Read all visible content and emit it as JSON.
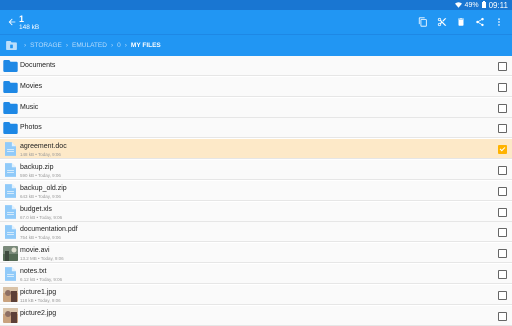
{
  "status": {
    "battery": "49%",
    "time": "09:11"
  },
  "appbar": {
    "title": "1",
    "subtitle": "148 kB"
  },
  "colors": {
    "primary": "#2196f3",
    "statusbar": "#1976d2",
    "selected_row": "#fde9c8",
    "checkbox_on": "#ffb300",
    "folder": "#1e88e5",
    "file_icon": "#90caf9"
  },
  "breadcrumb": [
    "STORAGE",
    "EMULATED",
    "0",
    "MY FILES"
  ],
  "rows": [
    {
      "name": "Documents",
      "type": "folder"
    },
    {
      "name": "Movies",
      "type": "folder"
    },
    {
      "name": "Music",
      "type": "folder"
    },
    {
      "name": "Photos",
      "type": "folder"
    },
    {
      "name": "agreement.doc",
      "meta": "148 kB • Today, 9:06",
      "type": "doc",
      "checked": true
    },
    {
      "name": "backup.zip",
      "meta": "590 kB • Today, 9:06",
      "type": "zip"
    },
    {
      "name": "backup_old.zip",
      "meta": "643 kB • Today, 9:06",
      "type": "zip"
    },
    {
      "name": "budget.xls",
      "meta": "67.0 kB • Today, 9:06",
      "type": "xls"
    },
    {
      "name": "documentation.pdf",
      "meta": "754 kB • Today, 9:06",
      "type": "pdf"
    },
    {
      "name": "movie.avi",
      "meta": "13.2 MB • Today, 9:06",
      "type": "video"
    },
    {
      "name": "notes.txt",
      "meta": "6.12 kB • Today, 9:06",
      "type": "txt"
    },
    {
      "name": "picture1.jpg",
      "meta": "118 kB • Today, 9:06",
      "type": "image"
    },
    {
      "name": "picture2.jpg",
      "meta": "",
      "type": "image"
    }
  ]
}
